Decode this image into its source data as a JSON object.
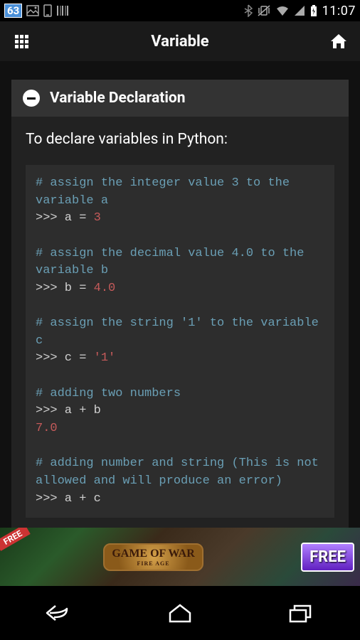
{
  "statusbar": {
    "badge": "63",
    "time": "11:07"
  },
  "appbar": {
    "title": "Variable"
  },
  "section": {
    "title": "Variable Declaration",
    "intro": "To declare variables in Python:"
  },
  "code": {
    "c1": "# assign the integer value 3 to the variable a",
    "p1": ">>> a = ",
    "v1": "3",
    "c2": "# assign the decimal value 4.0 to the variable b",
    "p2": ">>> b = ",
    "v2": "4.0",
    "c3": "# assign the string '1' to the variable c",
    "p3": ">>> c = ",
    "v3": "'1'",
    "c4": "# adding two numbers",
    "p4": ">>> a + b",
    "o4": "7.0",
    "c5": "# adding number and string (This is not allowed and will produce an error)",
    "p5": ">>> a + c"
  },
  "ad": {
    "free_left": "FREE",
    "logo_top": "GAME OF WAR",
    "logo_bottom": "FIRE AGE",
    "free_right": "FREE"
  }
}
